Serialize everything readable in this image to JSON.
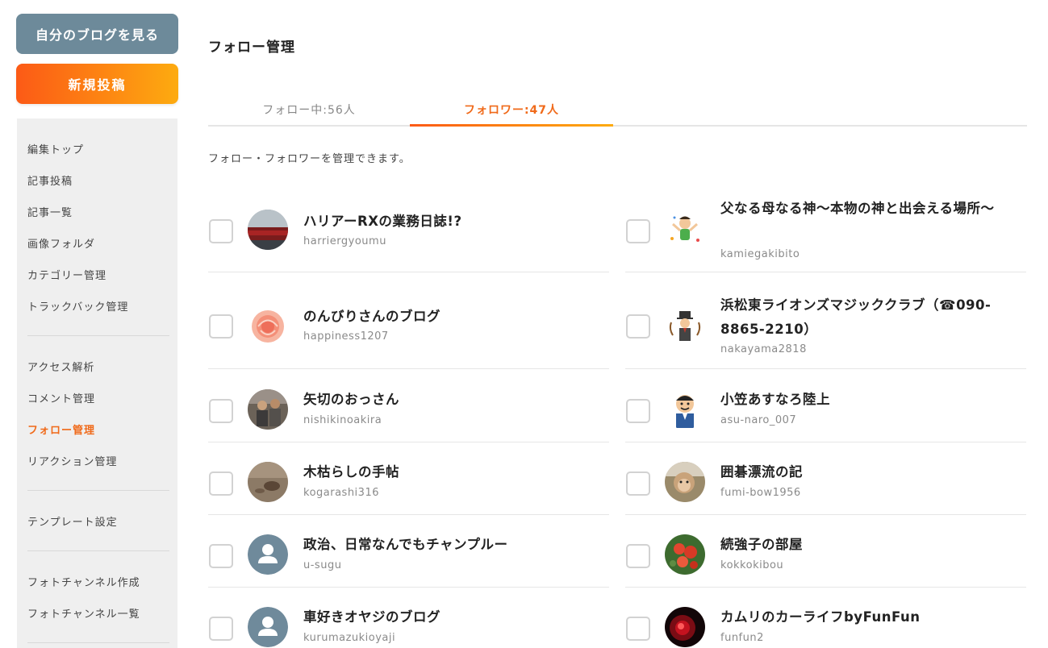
{
  "sidebar": {
    "myblog_button": "自分のブログを見る",
    "newpost_button": "新規投稿",
    "groups": [
      [
        "編集トップ",
        "記事投稿",
        "記事一覧",
        "画像フォルダ",
        "カテゴリー管理",
        "トラックバック管理"
      ],
      [
        "アクセス解析",
        "コメント管理",
        "フォロー管理",
        "リアクション管理"
      ],
      [
        "テンプレート設定"
      ],
      [
        "フォトチャンネル作成",
        "フォトチャンネル一覧"
      ]
    ],
    "active_item": "フォロー管理"
  },
  "main": {
    "title": "フォロー管理",
    "tabs": [
      {
        "label": "フォロー中:56人",
        "active": false
      },
      {
        "label": "フォロワー:47人",
        "active": true
      }
    ],
    "description": "フォロー・フォロワーを管理できます。",
    "followers": [
      {
        "title": "ハリアーRXの業務日誌!?",
        "id": "harriergyoumu",
        "avatar": "car-photo"
      },
      {
        "title": "父なる母なる神～本物の神と出会える場所～",
        "id": "kamiegakibito",
        "avatar": "celebrating-person-illustration"
      },
      {
        "title": "のんびりさんのブログ",
        "id": "happiness1207",
        "avatar": "rose-photo"
      },
      {
        "title": "浜松東ライオンズマジッククラブ（☎090-8865-2210）",
        "id": "nakayama2818",
        "avatar": "magician-illustration"
      },
      {
        "title": "矢切のおっさん",
        "id": "nishikinoakira",
        "avatar": "people-photo"
      },
      {
        "title": "小笠あすなろ陸上",
        "id": "asu-naro_007",
        "avatar": "man-illustration"
      },
      {
        "title": "木枯らしの手帖",
        "id": "kogarashi316",
        "avatar": "stone-photo"
      },
      {
        "title": "囲碁漂流の記",
        "id": "fumi-bow1956",
        "avatar": "monkey-photo"
      },
      {
        "title": "政治、日常なんでもチャンプルー",
        "id": "u-sugu",
        "avatar": "default-user-icon"
      },
      {
        "title": "続強子の部屋",
        "id": "kokkokibou",
        "avatar": "flowers-photo"
      },
      {
        "title": "車好きオヤジのブログ",
        "id": "kurumazukioyaji",
        "avatar": "default-user-icon"
      },
      {
        "title": "カムリのカーライフbyFunFun",
        "id": "funfun2",
        "avatar": "red-light-photo"
      }
    ]
  },
  "colors": {
    "accent": "#f06a1a",
    "myblog_button": "#6d8a9a",
    "sidebar_bg": "#efefef",
    "default_avatar": "#6f8a9b"
  }
}
